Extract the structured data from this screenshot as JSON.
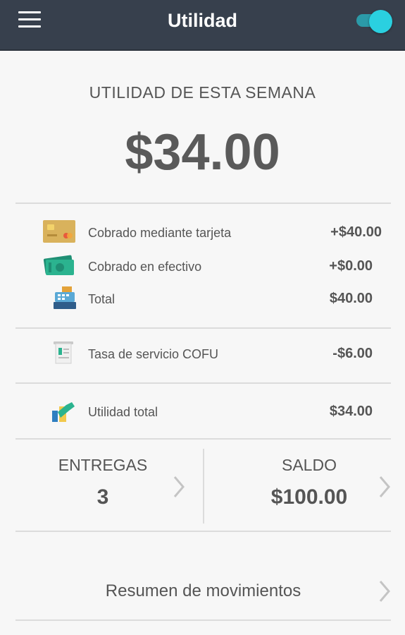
{
  "header": {
    "title": "Utilidad",
    "menu_icon": "hamburger-icon",
    "toggle": {
      "state": "on",
      "color": "#2ad0e0"
    }
  },
  "summary": {
    "label": "UTILIDAD DE ESTA SEMANA",
    "amount": "$34.00"
  },
  "breakdown": [
    {
      "icon": "credit-card-icon",
      "label": "Cobrado mediante tarjeta",
      "value": "+$40.00"
    },
    {
      "icon": "cash-icon",
      "label": "Cobrado en efectivo",
      "value": "+$0.00"
    },
    {
      "icon": "cash-register-icon",
      "label": "Total",
      "value": "$40.00"
    }
  ],
  "fee": {
    "icon": "receipt-icon",
    "label": "Tasa de servicio COFU",
    "value": "-$6.00"
  },
  "net": {
    "icon": "profit-chart-icon",
    "label": "Utilidad total",
    "value": "$34.00"
  },
  "stats": {
    "deliveries": {
      "label": "ENTREGAS",
      "value": "3"
    },
    "balance": {
      "label": "SALDO",
      "value": "$100.00"
    }
  },
  "movements": {
    "label": "Resumen de movimientos"
  },
  "colors": {
    "appbar": "#37404d",
    "accent": "#2ad0e0",
    "background": "#f7f7f7",
    "text": "#555555"
  }
}
